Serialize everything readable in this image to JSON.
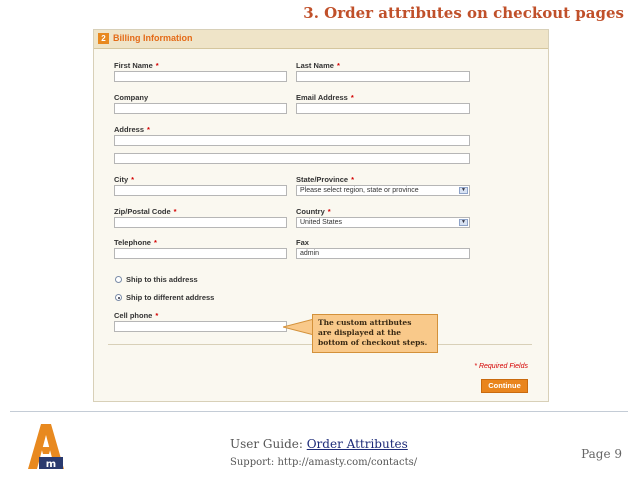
{
  "page_heading": "3. Order attributes on checkout pages",
  "section": {
    "step": "2",
    "title": "Billing Information"
  },
  "form": {
    "first_name_label": "First Name",
    "last_name_label": "Last Name",
    "company_label": "Company",
    "email_label": "Email Address",
    "address_label": "Address",
    "city_label": "City",
    "state_label": "State/Province",
    "state_value": "Please select region, state or province",
    "zip_label": "Zip/Postal Code",
    "country_label": "Country",
    "country_value": "United States",
    "telephone_label": "Telephone",
    "fax_label": "Fax",
    "fax_value": "admin",
    "required_mark": "*",
    "ship_same_label": "Ship to this address",
    "ship_diff_label": "Ship to different address",
    "ship_selected": "different",
    "cell_phone_label": "Cell phone",
    "required_fields_note": "* Required Fields",
    "continue_label": "Continue"
  },
  "callout": {
    "line1": "The  custom attributes",
    "line2": "are displayed at the",
    "line3": "bottom of checkout steps."
  },
  "footer": {
    "guide_prefix": "User Guide: ",
    "guide_link": "Order Attributes",
    "support": "Support: http://amasty.com/contacts/",
    "page": "Page 9"
  },
  "colors": {
    "heading": "#c0502a",
    "accent": "#e9851d",
    "required": "#d40000",
    "callout_bg": "#f9c98a"
  },
  "icons": {
    "logo": "amasty-logo",
    "dropdown": "chevron-down-icon"
  }
}
